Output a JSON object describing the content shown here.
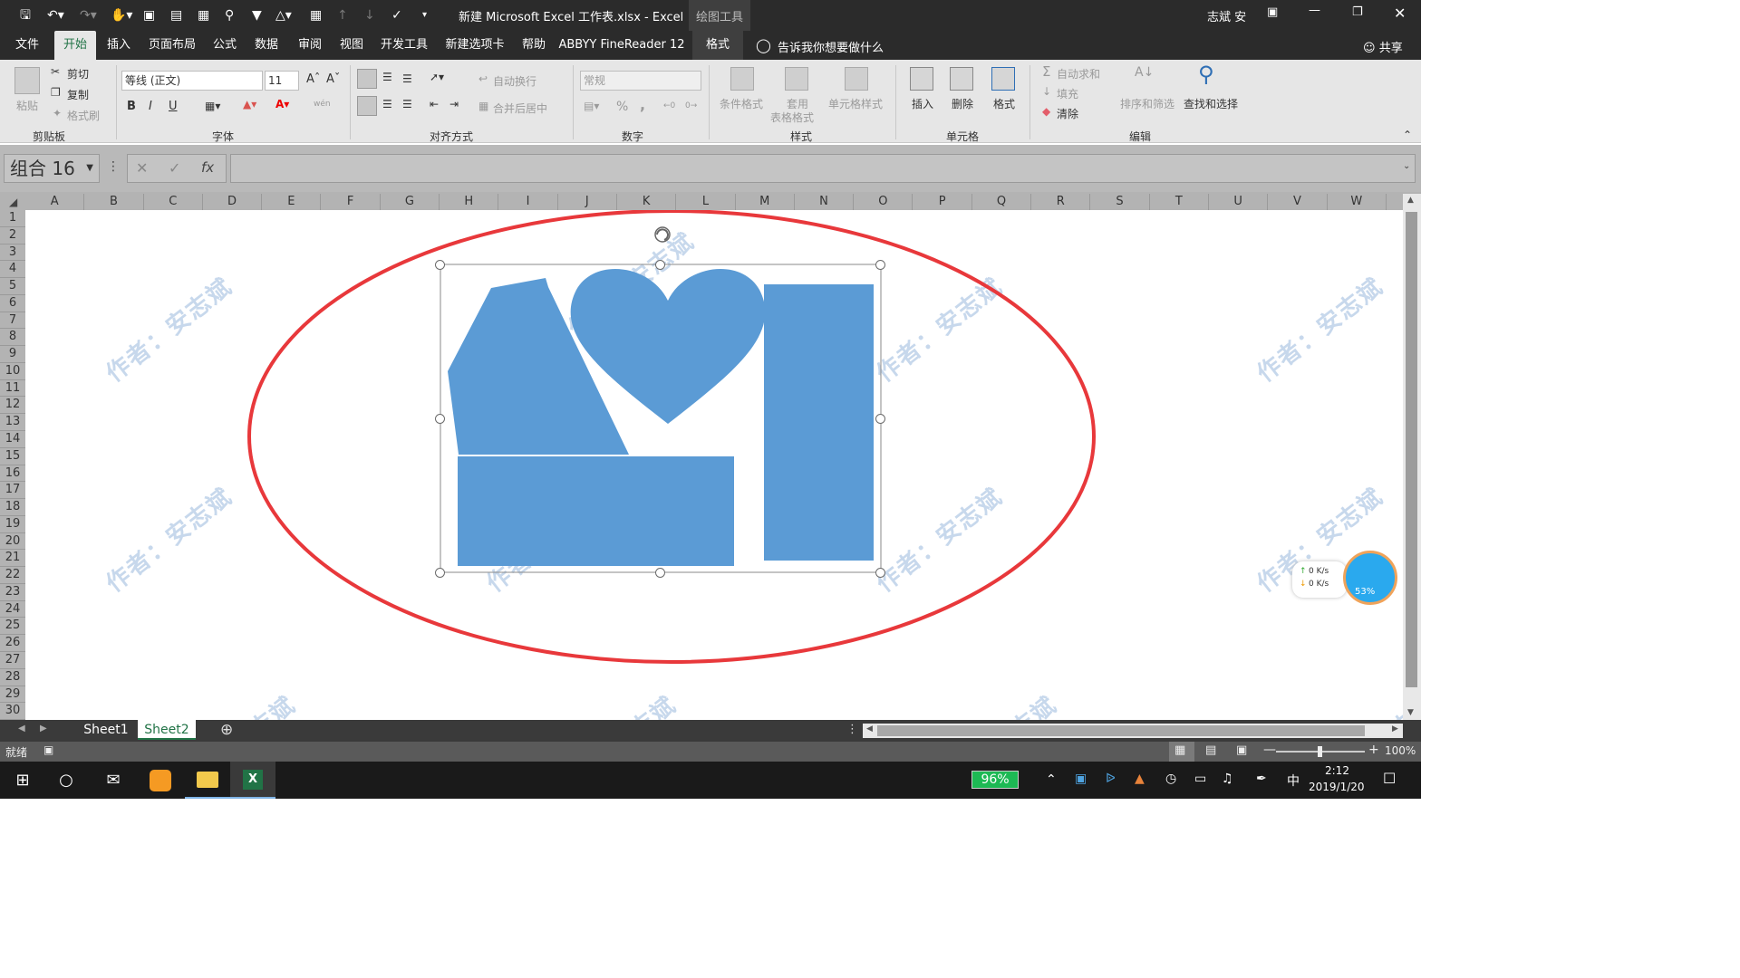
{
  "window": {
    "title": "新建 Microsoft Excel 工作表.xlsx  -  Excel",
    "context_tool": "绘图工具",
    "user": "志斌 安"
  },
  "tabs": [
    "文件",
    "开始",
    "插入",
    "页面布局",
    "公式",
    "数据",
    "审阅",
    "视图",
    "开发工具",
    "新建选项卡",
    "帮助",
    "ABBYY FineReader 12",
    "格式"
  ],
  "tell_me": "告诉我你想要做什么",
  "share": "共享",
  "ribbon": {
    "clipboard": {
      "paste": "粘贴",
      "cut": "剪切",
      "copy": "复制",
      "format_painter": "格式刷",
      "label": "剪贴板"
    },
    "font": {
      "name": "等线 (正文)",
      "size": "11",
      "bold": "B",
      "italic": "I",
      "underline": "U",
      "label": "字体",
      "phonetic": "wén"
    },
    "alignment": {
      "wrap": "自动换行",
      "merge": "合并后居中",
      "label": "对齐方式"
    },
    "number": {
      "format": "常规",
      "label": "数字",
      "percent": "%",
      "comma": ","
    },
    "styles": {
      "conditional": "条件格式",
      "table_format_1": "套用",
      "table_format_2": "表格格式",
      "cell_styles": "单元格样式",
      "label": "样式"
    },
    "cells": {
      "insert": "插入",
      "delete": "删除",
      "format": "格式",
      "label": "单元格"
    },
    "editing": {
      "autosum": "自动求和",
      "fill": "填充",
      "clear": "清除",
      "sort": "排序和筛选",
      "find": "查找和选择",
      "label": "编辑"
    }
  },
  "formula_bar": {
    "name_box": "组合 16",
    "fx": "fx",
    "value": ""
  },
  "columns": [
    "A",
    "B",
    "C",
    "D",
    "E",
    "F",
    "G",
    "H",
    "I",
    "J",
    "K",
    "L",
    "M",
    "N",
    "O",
    "P",
    "Q",
    "R",
    "S",
    "T",
    "U",
    "V",
    "W"
  ],
  "rows": [
    "1",
    "2",
    "3",
    "4",
    "5",
    "6",
    "7",
    "8",
    "9",
    "10",
    "11",
    "12",
    "13",
    "14",
    "15",
    "16",
    "17",
    "18",
    "19",
    "20",
    "21",
    "22",
    "23",
    "24",
    "25",
    "26",
    "27",
    "28",
    "29",
    "30"
  ],
  "watermark": "作者：安志斌",
  "sheets": [
    "Sheet1",
    "Sheet2"
  ],
  "active_sheet": "Sheet2",
  "status": {
    "ready": "就绪",
    "zoom": "100%"
  },
  "net_widget": {
    "up": "0  K/s",
    "down": "0  K/s",
    "percent": "53%"
  },
  "taskbar": {
    "battery": "96%",
    "time": "2:12",
    "date": "2019/1/20",
    "ime": "中"
  },
  "colors": {
    "shape_fill": "#5b9bd5",
    "ellipse": "#e8383b",
    "excel_green": "#217346"
  }
}
